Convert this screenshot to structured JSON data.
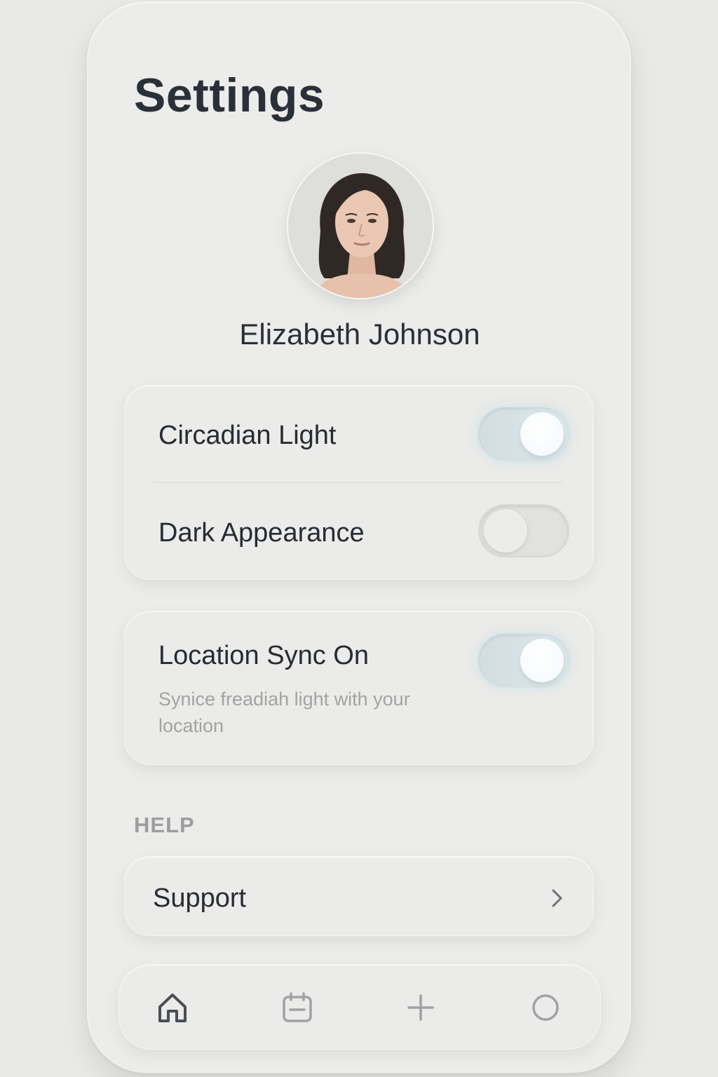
{
  "header": {
    "title": "Settings"
  },
  "profile": {
    "name": "Elizabeth Johnson",
    "avatar_icon": "user-avatar-photo"
  },
  "preferences": {
    "items": [
      {
        "label": "Circadian Light",
        "enabled": true
      },
      {
        "label": "Dark Appearance",
        "enabled": false
      }
    ]
  },
  "location": {
    "label": "Location Sync On",
    "description": "Synice freadiah light with your location",
    "enabled": true
  },
  "help": {
    "section_title": "HELP",
    "support_label": "Support",
    "support_icon": "chevron-right-icon"
  },
  "tab_bar": {
    "tabs": [
      {
        "name": "home",
        "icon": "home-icon",
        "active": true
      },
      {
        "name": "calendar",
        "icon": "calendar-icon",
        "active": false
      },
      {
        "name": "add",
        "icon": "plus-icon",
        "active": false
      },
      {
        "name": "profile",
        "icon": "circle-icon",
        "active": false
      }
    ]
  },
  "colors": {
    "background": "#e9e9e6",
    "surface": "#ebebe9",
    "text_primary": "#2b2f38",
    "text_secondary": "#a2a3a2",
    "toggle_on": "#d2dde0",
    "toggle_off": "#e1e1df"
  }
}
